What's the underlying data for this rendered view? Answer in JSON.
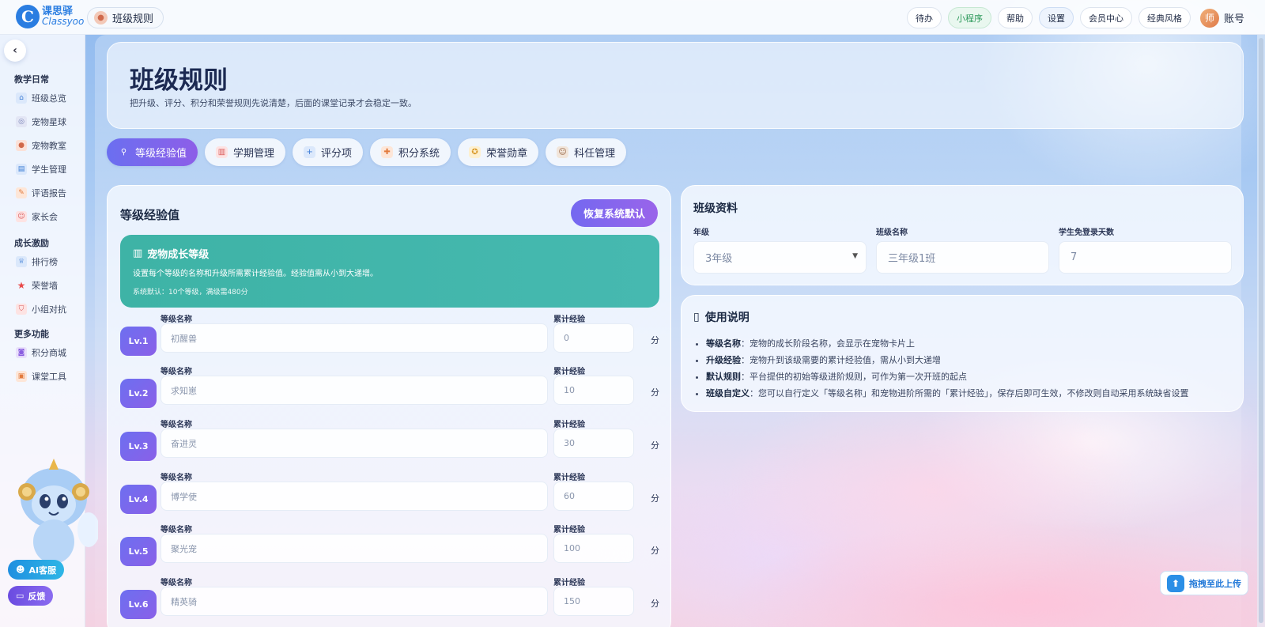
{
  "brand": {
    "logo_cn": "课思驿",
    "logo_en": "Classyoo"
  },
  "page_chip": "班级规则",
  "nav": {
    "items": [
      "待办",
      "小程序",
      "帮助",
      "设置",
      "会员中心",
      "经典风格"
    ],
    "avatar": "师",
    "account": "账号"
  },
  "sidebar": {
    "groups": [
      {
        "label": "教学日常",
        "items": [
          "班级总览",
          "宠物星球",
          "宠物教室",
          "学生管理",
          "评语报告",
          "家长会"
        ]
      },
      {
        "label": "成长激励",
        "items": [
          "排行榜",
          "荣誉墙",
          "小组对抗"
        ]
      },
      {
        "label": "更多功能",
        "items": [
          "积分商城",
          "课堂工具"
        ]
      }
    ],
    "ai_label": "AI客服",
    "feedback_label": "反馈"
  },
  "header": {
    "title": "班级规则",
    "subtitle": "把升级、评分、积分和荣誉规则先说清楚，后面的课堂记录才会稳定一致。"
  },
  "tabs": [
    "等级经验值",
    "学期管理",
    "评分项",
    "积分系统",
    "荣誉勋章",
    "科任管理"
  ],
  "levels": {
    "title": "等级经验值",
    "restore": "恢复系统默认",
    "banner": {
      "title": "宠物成长等级",
      "desc": "设置每个等级的名称和升级所需累计经验值。经验值需从小到大递增。",
      "note": "系统默认：10个等级，满级需480分"
    },
    "name_label": "等级名称",
    "exp_label": "累计经验",
    "unit": "分",
    "rows": [
      {
        "lv": "Lv.1",
        "name": "初醒兽",
        "exp": "0"
      },
      {
        "lv": "Lv.2",
        "name": "求知崽",
        "exp": "10"
      },
      {
        "lv": "Lv.3",
        "name": "奋进灵",
        "exp": "30"
      },
      {
        "lv": "Lv.4",
        "name": "博学使",
        "exp": "60"
      },
      {
        "lv": "Lv.5",
        "name": "聚光宠",
        "exp": "100"
      },
      {
        "lv": "Lv.6",
        "name": "精英骑",
        "exp": "150"
      }
    ]
  },
  "class_info": {
    "title": "班级资料",
    "grade_label": "年级",
    "grade_value": "3年级",
    "class_label": "班级名称",
    "class_placeholder": "三年级1班",
    "days_label": "学生免登录天数",
    "days_placeholder": "7"
  },
  "usage": {
    "title": "使用说明",
    "items": [
      {
        "term": "等级名称",
        "desc": "：宠物的成长阶段名称，会显示在宠物卡片上"
      },
      {
        "term": "升级经验",
        "desc": "：宠物升到该级需要的累计经验值，需从小到大递增"
      },
      {
        "term": "默认规则",
        "desc": "：平台提供的初始等级进阶规则，可作为第一次开班的起点"
      },
      {
        "term": "班级自定义",
        "desc": "：您可以自行定义「等级名称」和宠物进阶所需的「累计经验」，保存后即可生效，不修改则自动采用系统缺省设置"
      }
    ]
  },
  "upload_label": "拖拽至此上传"
}
